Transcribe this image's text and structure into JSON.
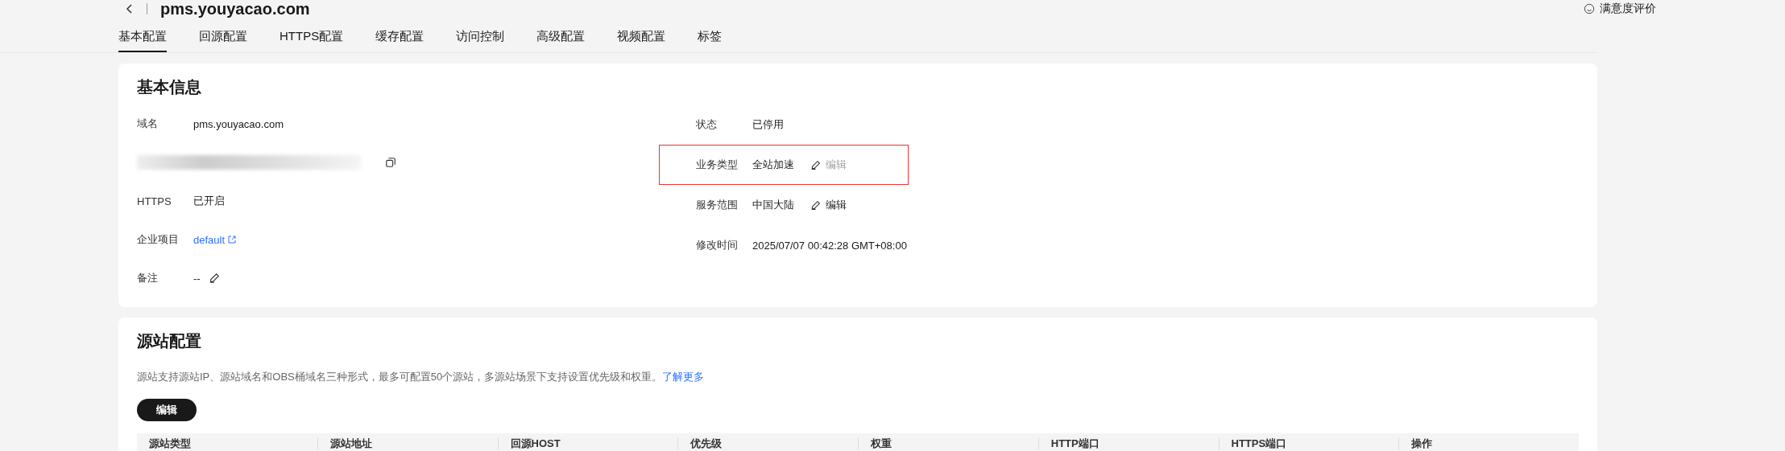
{
  "header": {
    "title": "pms.youyacao.com",
    "feedback": "满意度评价"
  },
  "tabs": [
    {
      "label": "基本配置",
      "selected": true
    },
    {
      "label": "回源配置",
      "selected": false
    },
    {
      "label": "HTTPS配置",
      "selected": false
    },
    {
      "label": "缓存配置",
      "selected": false
    },
    {
      "label": "访问控制",
      "selected": false
    },
    {
      "label": "高级配置",
      "selected": false
    },
    {
      "label": "视频配置",
      "selected": false
    },
    {
      "label": "标签",
      "selected": false
    }
  ],
  "basic_info": {
    "title": "基本信息",
    "left": [
      {
        "kind": "text",
        "label": "域名",
        "value": "pms.youyacao.com"
      },
      {
        "kind": "redacted"
      },
      {
        "kind": "text",
        "label": "HTTPS",
        "value": "已开启"
      },
      {
        "kind": "link",
        "label": "企业项目",
        "value": "default"
      },
      {
        "kind": "editable",
        "label": "备注",
        "value": "--"
      }
    ],
    "right": [
      {
        "label": "状态",
        "value": "已停用"
      },
      {
        "label": "业务类型",
        "value": "全站加速",
        "edit": "编辑",
        "disabled": true,
        "highlighted": true
      },
      {
        "label": "服务范围",
        "value": "中国大陆",
        "edit": "编辑",
        "disabled": false,
        "highlighted": false
      },
      {
        "label": "修改时间",
        "value": "2025/07/07 00:42:28 GMT+08:00"
      }
    ]
  },
  "origin": {
    "title": "源站配置",
    "description": "源站支持源站IP、源站域名和OBS桶域名三种形式，最多可配置50个源站，多源站场景下支持设置优先级和权重。",
    "link": "了解更多",
    "button": "编辑",
    "table": {
      "columns": [
        "源站类型",
        "源站地址",
        "回源HOST",
        "优先级",
        "权重",
        "HTTP端口",
        "HTTPS端口",
        "操作"
      ]
    }
  }
}
